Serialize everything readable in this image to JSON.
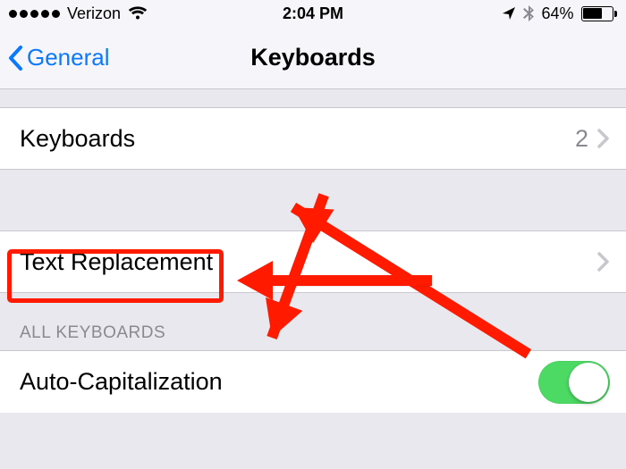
{
  "status_bar": {
    "carrier": "Verizon",
    "time": "2:04 PM",
    "battery_percent": "64%"
  },
  "nav": {
    "back_label": "General",
    "title": "Keyboards"
  },
  "rows": {
    "keyboards": {
      "label": "Keyboards",
      "value": "2"
    },
    "text_replacement": {
      "label": "Text Replacement"
    },
    "auto_cap": {
      "label": "Auto-Capitalization"
    }
  },
  "section": {
    "all_keyboards": "ALL KEYBOARDS"
  },
  "switch": {
    "auto_cap_on": true
  },
  "annotation": {
    "highlight_color": "#ff1a00"
  }
}
